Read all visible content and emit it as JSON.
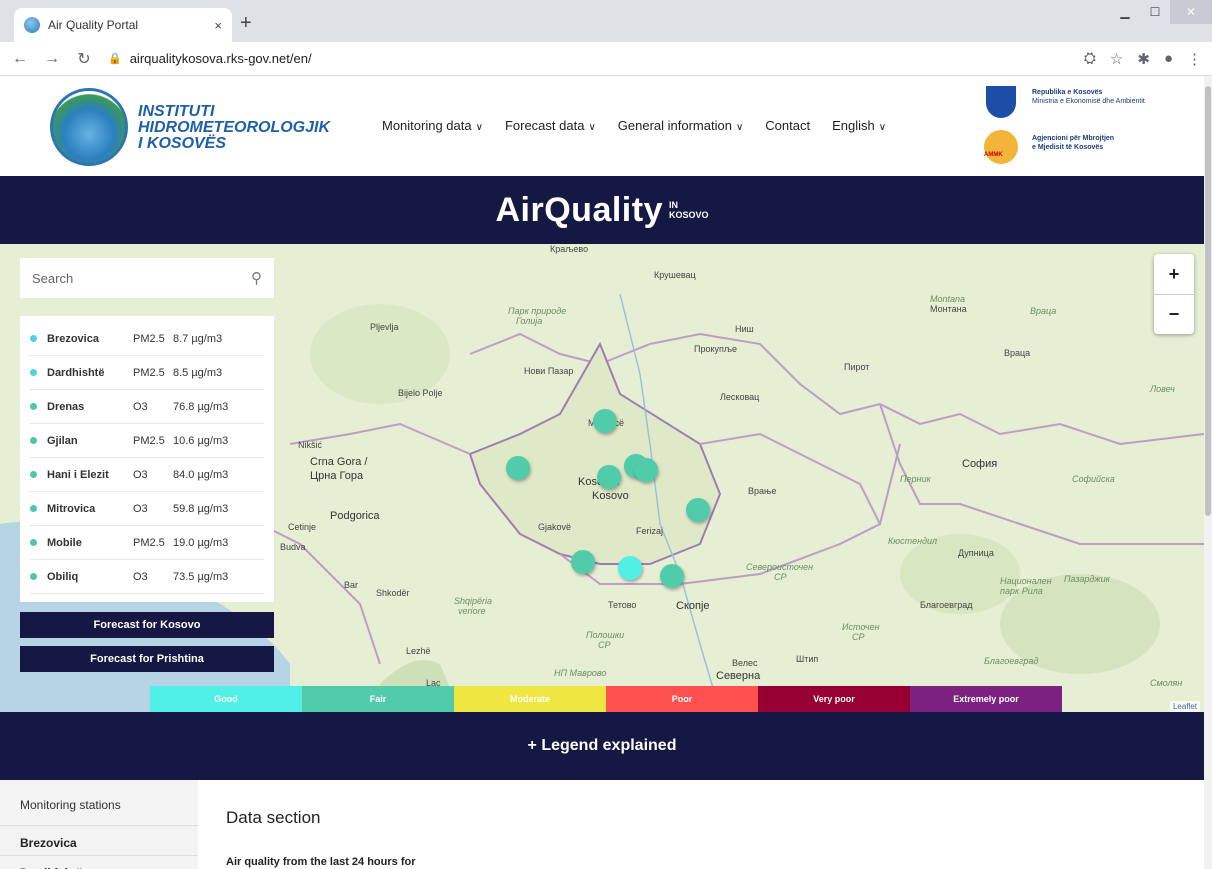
{
  "browser": {
    "tab_title": "Air Quality Portal",
    "tab_close": "×",
    "new_tab": "+",
    "url": "airqualitykosova.rks-gov.net/en/"
  },
  "header": {
    "logo_line1": "INSTITUTI",
    "logo_line2": "HIDROMETEOROLOGJIK",
    "logo_line3": "I KOSOVËS",
    "nav": [
      {
        "label": "Monitoring data"
      },
      {
        "label": "Forecast data"
      },
      {
        "label": "General information"
      },
      {
        "label": "Contact"
      },
      {
        "label": "English"
      }
    ],
    "gov_title": "Republika e Kosovës",
    "gov_ministry": "Ministria e Ekonomisë dhe Ambientit",
    "agency_line1": "Agjencioni për Mbrojtjen",
    "agency_line2": "e Mjedisit të Kosovës",
    "agency_abbr": "AMMK"
  },
  "banner": {
    "title": "AirQuality",
    "in": "IN",
    "kosovo": "KOSOVO"
  },
  "search": {
    "placeholder": "Search"
  },
  "stations": [
    {
      "name": "Brezovica",
      "pollutant": "PM2.5",
      "value": "8.7 µg/m3",
      "color": "#50d3e0"
    },
    {
      "name": "Dardhishtë",
      "pollutant": "PM2.5",
      "value": "8.5 µg/m3",
      "color": "#50d3e0"
    },
    {
      "name": "Drenas",
      "pollutant": "O3",
      "value": "76.8 µg/m3",
      "color": "#4ec7a8"
    },
    {
      "name": "Gjilan",
      "pollutant": "PM2.5",
      "value": "10.6 µg/m3",
      "color": "#4ec7a8"
    },
    {
      "name": "Hani i Elezit",
      "pollutant": "O3",
      "value": "84.0 µg/m3",
      "color": "#4ec7a8"
    },
    {
      "name": "Mitrovica",
      "pollutant": "O3",
      "value": "59.8 µg/m3",
      "color": "#4ec7a8"
    },
    {
      "name": "Mobile",
      "pollutant": "PM2.5",
      "value": "19.0 µg/m3",
      "color": "#4ec7a8"
    },
    {
      "name": "Obiliq",
      "pollutant": "O3",
      "value": "73.5 µg/m3",
      "color": "#4ec7a8"
    }
  ],
  "forecast": {
    "kosovo": "Forecast for Kosovo",
    "prishtina": "Forecast for Prishtina"
  },
  "zoom": {
    "in": "+",
    "out": "−"
  },
  "legend": [
    {
      "label": "Good",
      "color": "#50f0e6"
    },
    {
      "label": "Fair",
      "color": "#50ccaa"
    },
    {
      "label": "Moderate",
      "color": "#f0e641"
    },
    {
      "label": "Poor",
      "color": "#ff5050"
    },
    {
      "label": "Very poor",
      "color": "#960032"
    },
    {
      "label": "Extremely poor",
      "color": "#7d2181"
    }
  ],
  "map_labels": {
    "kraljevo": "Краљево",
    "krusevac": "Крушевац",
    "pljevlja": "Pljevlja",
    "park_golija_1": "Парк природе",
    "park_golija_2": "Голија",
    "nis": "Ниш",
    "prokuplje": "Прокупље",
    "novi_pazar": "Нови Пазар",
    "pirot": "Пирот",
    "bijelo_polje": "Bijelo Polje",
    "leskovac": "Лесковац",
    "niksic": "Nikšić",
    "crna_gora_1": "Crna Gora /",
    "crna_gora_2": "Црна Гора",
    "kosovo_1": "Kosova /",
    "kosovo_2": "Kosovo",
    "mitrovice": "Mitrovicë",
    "vranje": "Врање",
    "podgorica": "Podgorica",
    "cetinje": "Cetinje",
    "budva": "Budva",
    "gjakove": "Gjakovë",
    "ferizaj": "Ferizaj",
    "bar": "Bar",
    "shkoder": "Shkodër",
    "shqiperia_1": "Shqipëria",
    "shqiperia_2": "veriore",
    "tetovo": "Тетово",
    "skopje": "Скопје",
    "polog_1": "Полошки",
    "polog_2": "СР",
    "istocen_1": "Источен",
    "istocen_2": "СР",
    "severoist_1": "Североисточен",
    "severoist_2": "СР",
    "veles": "Велес",
    "stip": "Штип",
    "lezhe": "Lezhë",
    "lac": "Lac",
    "np_mavrovo": "НП Маврово",
    "severna": "Северна",
    "sofia": "София",
    "sofiyska": "Софийска",
    "montana_1": "Montana",
    "montana_2": "Монтана",
    "vraca": "Враца",
    "vraca2": "Врaца",
    "lovech": "Ловеч",
    "pernik": "Перник",
    "kyustendil": "Кюстендил",
    "dupnitsa": "Дупница",
    "blagoevgrad": "Благоевград",
    "blagoevgrad2": "Благоевград",
    "pazardzhik": "Пазарджик",
    "nac_park_1": "Национален",
    "nac_park_2": "парк Рила",
    "smolyan": "Смолян",
    "leaflet": "Leaflet"
  },
  "legend_explained": "+ Legend explained",
  "bottom": {
    "side_header": "Monitoring stations",
    "side_item_1": "Brezovica",
    "side_item_2": "Dardhishtë",
    "section_title": "Data section",
    "section_sub": "Air quality from the last 24 hours for"
  }
}
